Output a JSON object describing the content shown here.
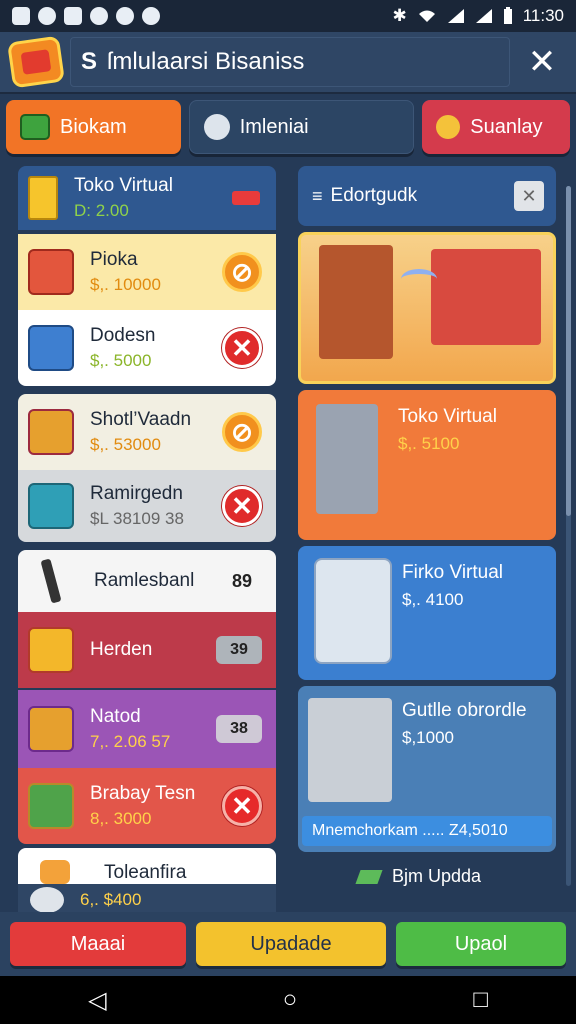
{
  "status_bar": {
    "time": "11:30",
    "bluetooth": "✱"
  },
  "header": {
    "title": "ſmlulaarsi Bisaniss",
    "close_symbol": "✕"
  },
  "tabs": [
    {
      "label": "Biokam"
    },
    {
      "label": "Imleniai"
    },
    {
      "label": "Suanlay"
    }
  ],
  "left_list": {
    "header": {
      "name": "Toko Virtual",
      "sub": "D: 2.00"
    },
    "items": [
      {
        "name": "Pioka",
        "price": "$,. 10000",
        "action": "⊘"
      },
      {
        "name": "Dodesn",
        "price": "$,. 5000",
        "action": "✕"
      },
      {
        "name": "Shotl’Vaadn",
        "price": "$,. 53000",
        "action": "⊘"
      },
      {
        "name": "Ramirgedn",
        "price": "$L 38109 38",
        "action": "✕"
      },
      {
        "name": "Ramlesbanl",
        "price": "",
        "action": "89"
      },
      {
        "name": "Herden",
        "price": "",
        "action": "39"
      },
      {
        "name": "Natod",
        "price": "7,. 2.06 57",
        "action": "38"
      },
      {
        "name": "Brabay Tesn",
        "price": "8,. 3000",
        "action": "✕"
      },
      {
        "name": "Toleanfira",
        "price": "6,. $400",
        "action": ""
      }
    ]
  },
  "right_panel": {
    "header": {
      "label": "Edortgudk",
      "close_symbol": "✕"
    },
    "items": [
      {
        "name": "Toko Virtual",
        "price": "$,. 5100"
      },
      {
        "name": "Firko Virtual",
        "price": "$,. 4100"
      },
      {
        "name": "Gutlle obrordle",
        "price": "$,1000",
        "footer": "Mnemchorkam ..... Z4,5010"
      }
    ],
    "update_label": "Bjm Updda"
  },
  "footer_buttons": [
    {
      "label": "Maaai"
    },
    {
      "label": "Upadade"
    },
    {
      "label": "Upaol"
    }
  ],
  "nav": {
    "back": "◁",
    "home": "○",
    "recent": "□"
  }
}
